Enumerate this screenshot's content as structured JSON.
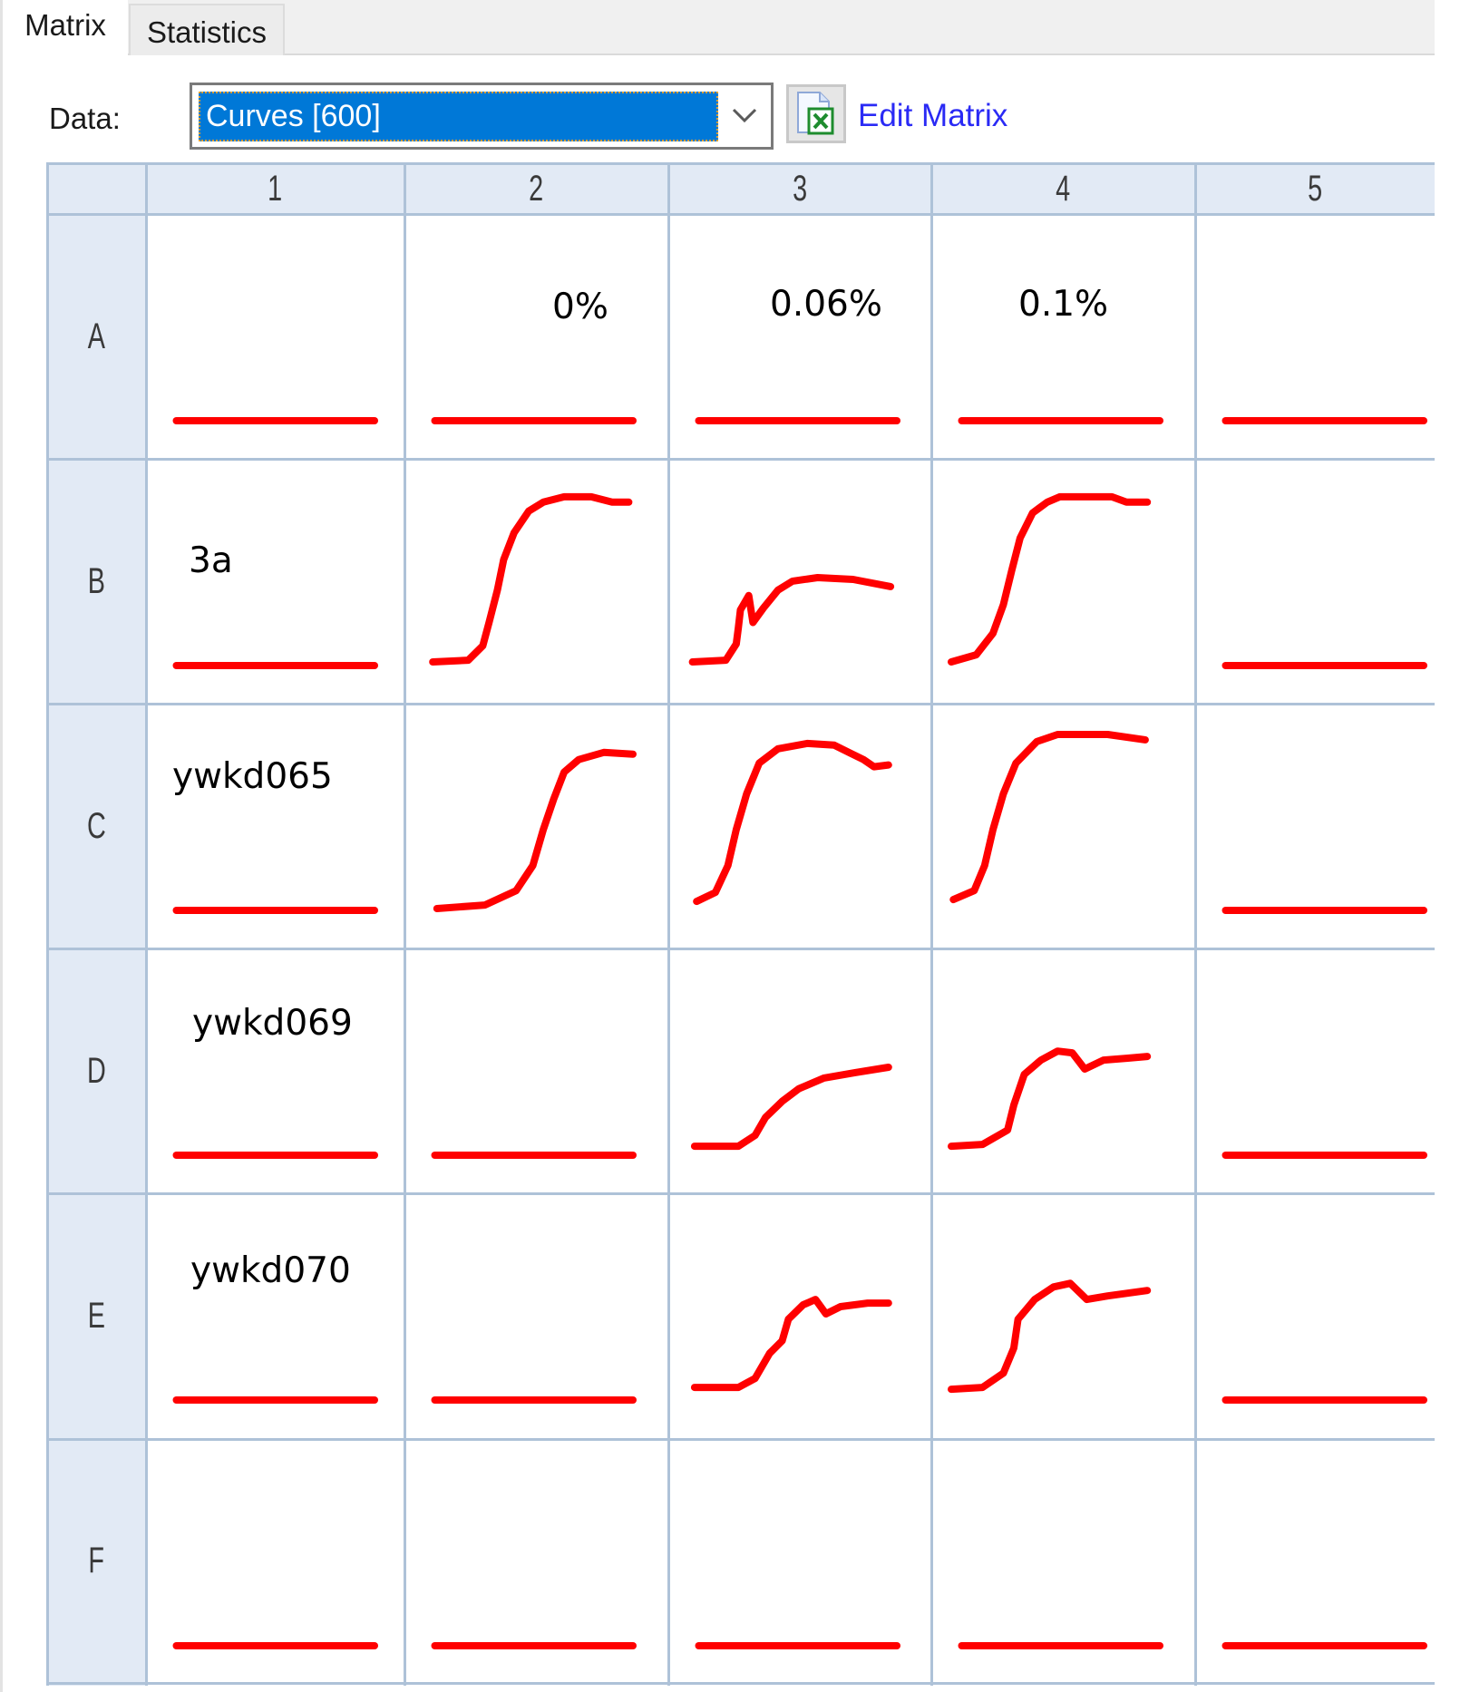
{
  "tabs": [
    {
      "label": "Matrix",
      "active": true
    },
    {
      "label": "Statistics",
      "active": false
    }
  ],
  "toolbar": {
    "data_label": "Data:",
    "data_select_value": "Curves [600]",
    "excel_icon": "excel-file-icon",
    "edit_matrix_label": "Edit Matrix"
  },
  "colors": {
    "curve": "#ff0000",
    "selection": "#0078d7",
    "header_bg": "#e2eaf5",
    "grid_line": "#aec2d8",
    "link": "#2a2af5"
  },
  "matrix": {
    "columns": [
      "1",
      "2",
      "3",
      "4",
      "5"
    ],
    "rows": [
      "A",
      "B",
      "C",
      "D",
      "E",
      "F"
    ],
    "cell_labels": {
      "A2": "0%",
      "A3": "0.06%",
      "A4": "0.1%",
      "B1": "3a",
      "C1": "ywkd065",
      "D1": "ywkd069",
      "E1": "ywkd070"
    }
  },
  "chart_data": {
    "type": "line",
    "title": "Curves [600]",
    "description": "Small-multiple growth curves per well; t is fraction of time axis (0-1), v is fraction of value axis (0-1)",
    "xlim": [
      0,
      1
    ],
    "ylim": [
      0,
      1
    ],
    "flat_wells": [
      "A1",
      "A2",
      "A3",
      "A4",
      "A5",
      "B1",
      "B5",
      "C1",
      "C5",
      "D1",
      "D2",
      "D5",
      "E1",
      "E2",
      "E5",
      "F1",
      "F2",
      "F3",
      "F4",
      "F5"
    ],
    "flat_series": {
      "t": [
        0.05,
        1.0
      ],
      "v": [
        0.0,
        0.0
      ]
    },
    "series": [
      {
        "name": "B2",
        "t": [
          0.04,
          0.21,
          0.28,
          0.31,
          0.35,
          0.38,
          0.43,
          0.5,
          0.57,
          0.67,
          0.8,
          0.9,
          0.98
        ],
        "v": [
          0.02,
          0.03,
          0.11,
          0.24,
          0.42,
          0.59,
          0.74,
          0.86,
          0.91,
          0.94,
          0.94,
          0.91,
          0.91
        ]
      },
      {
        "name": "B3",
        "t": [
          0.02,
          0.18,
          0.23,
          0.24,
          0.25,
          0.29,
          0.31,
          0.36,
          0.43,
          0.5,
          0.62,
          0.79,
          0.97
        ],
        "v": [
          0.02,
          0.03,
          0.12,
          0.21,
          0.31,
          0.39,
          0.24,
          0.32,
          0.42,
          0.47,
          0.49,
          0.48,
          0.44
        ]
      },
      {
        "name": "B4",
        "t": [
          0.0,
          0.12,
          0.2,
          0.25,
          0.29,
          0.33,
          0.39,
          0.46,
          0.52,
          0.77,
          0.84,
          0.94
        ],
        "v": [
          0.02,
          0.06,
          0.18,
          0.34,
          0.53,
          0.71,
          0.85,
          0.91,
          0.94,
          0.94,
          0.91,
          0.91
        ]
      },
      {
        "name": "C2",
        "t": [
          0.06,
          0.29,
          0.44,
          0.52,
          0.57,
          0.62,
          0.67,
          0.74,
          0.86,
          1.0
        ],
        "v": [
          0.01,
          0.03,
          0.11,
          0.25,
          0.45,
          0.62,
          0.77,
          0.84,
          0.88,
          0.87
        ]
      },
      {
        "name": "C3",
        "t": [
          0.04,
          0.13,
          0.19,
          0.23,
          0.28,
          0.34,
          0.43,
          0.57,
          0.7,
          0.77,
          0.84,
          0.89,
          0.96
        ],
        "v": [
          0.05,
          0.1,
          0.25,
          0.45,
          0.65,
          0.82,
          0.9,
          0.93,
          0.92,
          0.88,
          0.84,
          0.8,
          0.81
        ]
      },
      {
        "name": "C4",
        "t": [
          0.01,
          0.11,
          0.16,
          0.2,
          0.25,
          0.31,
          0.41,
          0.51,
          0.75,
          0.93
        ],
        "v": [
          0.06,
          0.11,
          0.25,
          0.45,
          0.65,
          0.82,
          0.94,
          0.98,
          0.98,
          0.95
        ]
      },
      {
        "name": "D3",
        "t": [
          0.03,
          0.24,
          0.32,
          0.37,
          0.45,
          0.53,
          0.65,
          0.8,
          0.96
        ],
        "v": [
          0.05,
          0.05,
          0.11,
          0.21,
          0.3,
          0.37,
          0.43,
          0.46,
          0.49
        ]
      },
      {
        "name": "D4",
        "t": [
          0.0,
          0.15,
          0.27,
          0.3,
          0.35,
          0.43,
          0.51,
          0.58,
          0.64,
          0.73,
          0.84,
          0.94
        ],
        "v": [
          0.05,
          0.06,
          0.14,
          0.28,
          0.45,
          0.53,
          0.58,
          0.57,
          0.48,
          0.53,
          0.54,
          0.55
        ]
      },
      {
        "name": "E3",
        "t": [
          0.03,
          0.24,
          0.32,
          0.39,
          0.45,
          0.48,
          0.55,
          0.61,
          0.66,
          0.73,
          0.86,
          0.96
        ],
        "v": [
          0.07,
          0.07,
          0.12,
          0.26,
          0.33,
          0.45,
          0.53,
          0.56,
          0.48,
          0.52,
          0.54,
          0.54
        ]
      },
      {
        "name": "E4",
        "t": [
          0.0,
          0.15,
          0.25,
          0.3,
          0.32,
          0.4,
          0.49,
          0.57,
          0.65,
          0.75,
          0.94
        ],
        "v": [
          0.06,
          0.07,
          0.15,
          0.29,
          0.45,
          0.56,
          0.63,
          0.65,
          0.56,
          0.58,
          0.61
        ]
      }
    ]
  }
}
